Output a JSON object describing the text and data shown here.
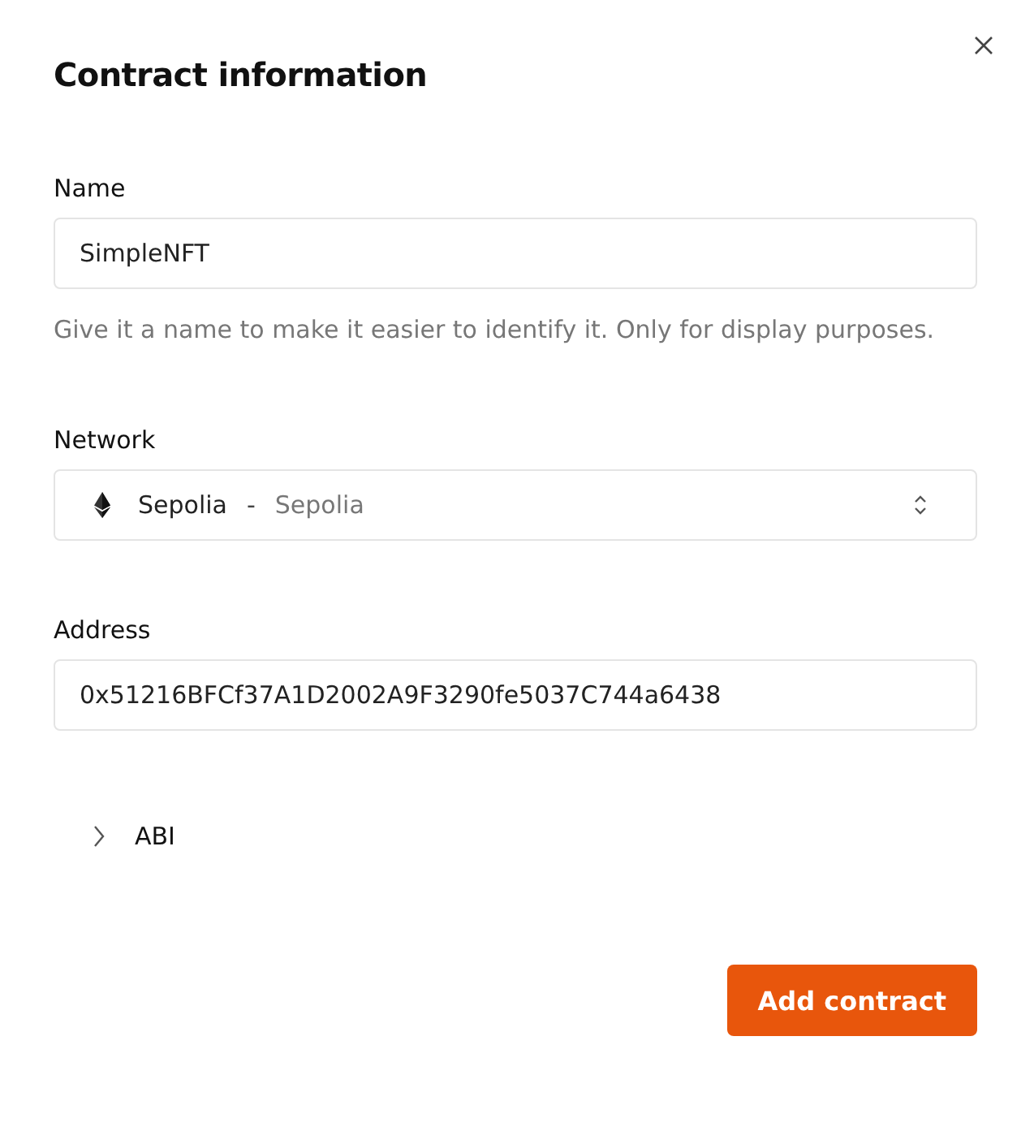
{
  "dialog": {
    "title": "Contract information"
  },
  "name_field": {
    "label": "Name",
    "value": "SimpleNFT",
    "help": "Give it a name to make it easier to identify it. Only for display purposes."
  },
  "network_field": {
    "label": "Network",
    "value": "Sepolia",
    "separator": "-",
    "detail": "Sepolia"
  },
  "address_field": {
    "label": "Address",
    "value": "0x51216BFCf37A1D2002A9F3290fe5037C744a6438"
  },
  "abi_section": {
    "label": "ABI",
    "expanded": false
  },
  "buttons": [
    "Add contract"
  ]
}
